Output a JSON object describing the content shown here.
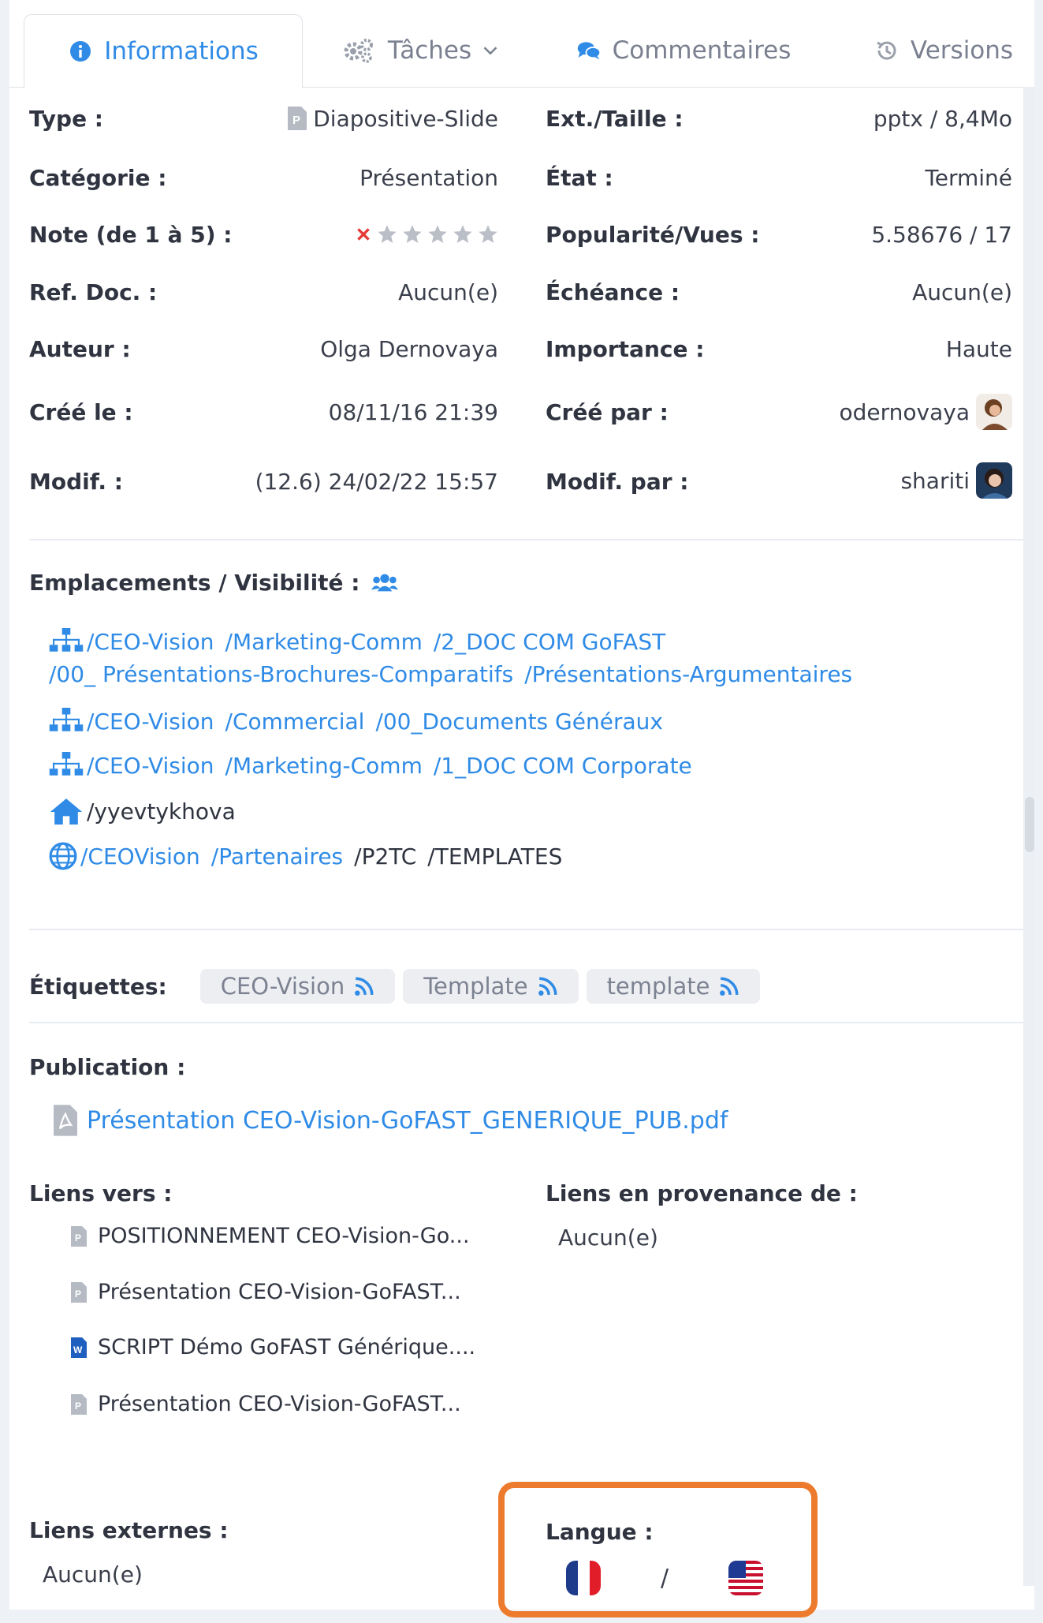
{
  "tabs": [
    {
      "label": "Informations",
      "icon": "info-circle-icon"
    },
    {
      "label": "Tâches",
      "icon": "gears-icon"
    },
    {
      "label": "Commentaires",
      "icon": "comments-icon"
    },
    {
      "label": "Versions",
      "icon": "history-icon"
    }
  ],
  "left_fields": [
    {
      "label": "Type :",
      "value": "Diapositive-Slide"
    },
    {
      "label": "Catégorie :",
      "value": "Présentation"
    },
    {
      "label": "Note (de 1 à 5) :",
      "value": ""
    },
    {
      "label": "Ref. Doc. :",
      "value": "Aucun(e)"
    },
    {
      "label": "Auteur :",
      "value": "Olga Dernovaya"
    },
    {
      "label": "Créé le :",
      "value": "08/11/16 21:39"
    },
    {
      "label": "Modif. :",
      "value": "(12.6) 24/02/22 15:57"
    }
  ],
  "right_fields": [
    {
      "label": "Ext./Taille :",
      "value": "pptx / 8,4Mo"
    },
    {
      "label": "État :",
      "value": "Terminé"
    },
    {
      "label": "Popularité/Vues :",
      "value": "5.58676 / 17"
    },
    {
      "label": "Échéance :",
      "value": "Aucun(e)"
    },
    {
      "label": "Importance :",
      "value": "Haute"
    },
    {
      "label": "Créé par :",
      "value": "odernovaya"
    },
    {
      "label": "Modif. par :",
      "value": "shariti"
    }
  ],
  "rating": {
    "max": 5,
    "value": 0
  },
  "locations": {
    "label": "Emplacements / Visibilité :",
    "paths": [
      {
        "icon": "sitemap-icon",
        "line1": [
          "/CEO-Vision",
          "/Marketing-Comm",
          "/2_DOC COM GoFAST"
        ],
        "line2": [
          "/00_ Présentations-Brochures-Comparatifs",
          "/Présentations-Argumentaires"
        ]
      },
      {
        "icon": "sitemap-icon",
        "line1": [
          "/CEO-Vision",
          "/Commercial",
          "/00_Documents Généraux"
        ]
      },
      {
        "icon": "sitemap-icon",
        "line1": [
          "/CEO-Vision",
          "/Marketing-Comm",
          "/1_DOC COM Corporate"
        ]
      },
      {
        "icon": "home-icon",
        "line1": [
          "/yyevtykhova"
        ]
      },
      {
        "icon": "globe-icon",
        "line1": [
          "/CEOVision",
          "/Partenaires",
          "/P2TC",
          "/TEMPLATES"
        ]
      }
    ]
  },
  "tags": {
    "label": "Étiquettes:",
    "items": [
      "CEO-Vision",
      "Template",
      "template"
    ]
  },
  "publication": {
    "label": "Publication :",
    "file": "Présentation CEO-Vision-GoFAST_GENERIQUE_PUB.pdf"
  },
  "links_to": {
    "label": "Liens vers :",
    "items": [
      {
        "icon": "pptx-file-icon",
        "text": "POSITIONNEMENT CEO-Vision-Go..."
      },
      {
        "icon": "pptx-file-icon",
        "text": "Présentation CEO-Vision-GoFAST..."
      },
      {
        "icon": "word-file-icon",
        "text": "SCRIPT Démo GoFAST Générique...."
      },
      {
        "icon": "pptx-file-icon",
        "text": "Présentation CEO-Vision-GoFAST..."
      }
    ]
  },
  "links_from": {
    "label": "Liens en provenance de :",
    "value": "Aucun(e)"
  },
  "external_links": {
    "label": "Liens externes :",
    "value": "Aucun(e)"
  },
  "language": {
    "label": "Langue :",
    "separator": "/",
    "flags": [
      "france-flag-icon",
      "usa-flag-icon"
    ]
  },
  "colors": {
    "accent": "#2f8be6",
    "highlight": "#ec7b2d"
  }
}
